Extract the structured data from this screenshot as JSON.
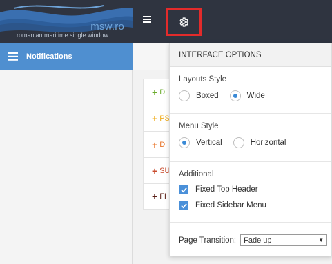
{
  "brand": {
    "name": "msw.ro",
    "tagline": "romanian maritime single window"
  },
  "topbar": {
    "menu_icon": "hamburger-menu-icon",
    "settings_icon": "gear-icon",
    "highlight_color": "#e32b2b"
  },
  "sidebar": {
    "items": [
      {
        "label": "Notifications",
        "icon": "list-icon",
        "active": true
      }
    ],
    "accent": "#4f8fd0"
  },
  "main": {
    "items": [
      {
        "label": "D",
        "color": "#6aab2b"
      },
      {
        "label": "PS",
        "color": "#f0ad1c"
      },
      {
        "label": "D",
        "color": "#e8742a"
      },
      {
        "label": "SU",
        "color": "#c94c2e"
      },
      {
        "label": "FI",
        "color": "#5a1f16"
      }
    ]
  },
  "panel": {
    "title": "INTERFACE OPTIONS",
    "layout": {
      "title": "Layouts Style",
      "options": [
        {
          "label": "Boxed",
          "selected": false
        },
        {
          "label": "Wide",
          "selected": true
        }
      ]
    },
    "menu": {
      "title": "Menu Style",
      "options": [
        {
          "label": "Vertical",
          "selected": true
        },
        {
          "label": "Horizontal",
          "selected": false
        }
      ]
    },
    "additional": {
      "title": "Additional",
      "checks": [
        {
          "label": "Fixed Top Header",
          "checked": true
        },
        {
          "label": "Fixed Sidebar Menu",
          "checked": true
        }
      ]
    },
    "transition": {
      "label": "Page Transition:",
      "value": "Fade up"
    }
  }
}
